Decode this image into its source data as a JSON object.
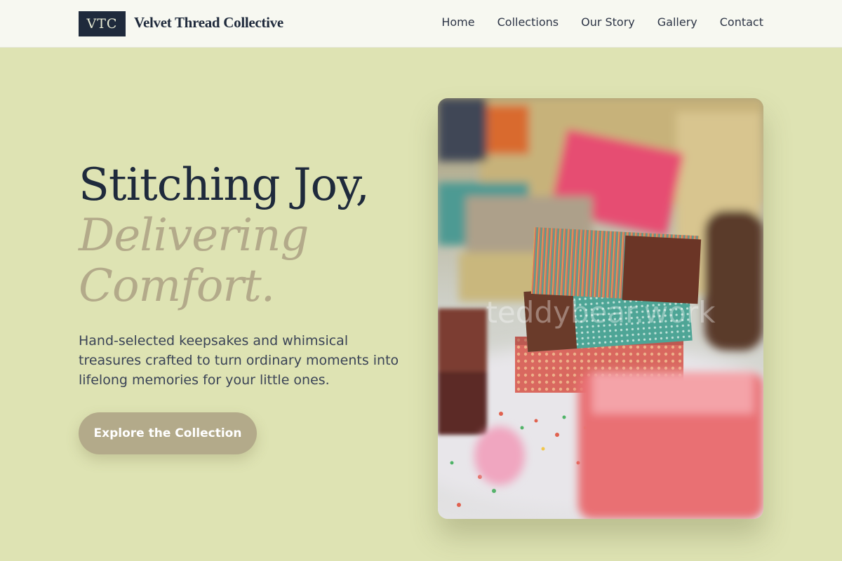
{
  "header": {
    "logo_mark": "VTC",
    "brand_name": "Velvet Thread Collective",
    "nav": [
      "Home",
      "Collections",
      "Our Story",
      "Gallery",
      "Contact"
    ]
  },
  "hero": {
    "title_line1": "Stitching Joy,",
    "title_line2": "Delivering",
    "title_line3": "Comfort.",
    "subtitle": "Hand-selected keepsakes and whimsical treasures crafted to turn ordinary moments into lifelong memories for your little ones.",
    "cta_label": "Explore the Collection"
  },
  "image": {
    "watermark": "teddybear.work",
    "subject": "stacked handmade soap bars in patterned paper wrappers"
  },
  "colors": {
    "background": "#dee3b3",
    "header_bg": "#f7f8f1",
    "navy": "#1f2a3c",
    "accent_taupe": "#b3aa8a"
  }
}
